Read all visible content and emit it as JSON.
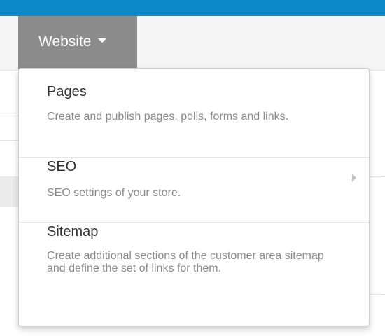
{
  "nav": {
    "website_label": "Website"
  },
  "menu": {
    "items": [
      {
        "title": "Pages",
        "description": "Create and publish pages, polls, forms and links."
      },
      {
        "title": "SEO",
        "description": "SEO settings of your store.",
        "has_submenu": true
      },
      {
        "title": "Sitemap",
        "description": "Create additional sections of the customer area sitemap and define the set of links for them."
      }
    ]
  },
  "colors": {
    "top_bar": "#0b8ac9",
    "active_tab": "#8c8c8c",
    "title_text": "#333333",
    "description_text": "#8a8a8a"
  },
  "icons": {
    "nav_caret": "caret-down-icon",
    "submenu": "chevron-right-icon"
  }
}
